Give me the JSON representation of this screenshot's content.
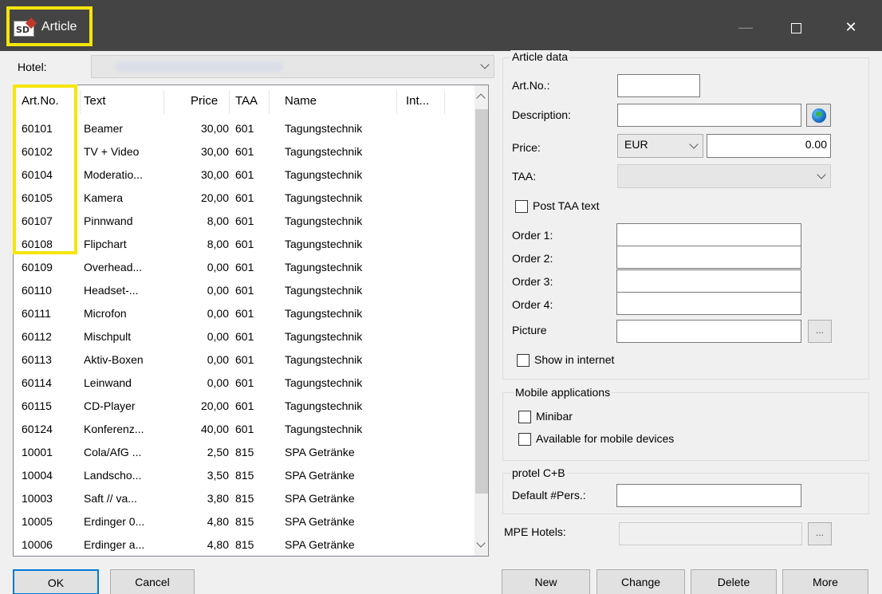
{
  "window": {
    "title": "Article",
    "icon_label": "SD",
    "controls": {
      "minimize": "—",
      "close": "✕"
    }
  },
  "hotel": {
    "label": "Hotel:",
    "value": ""
  },
  "article_list": {
    "columns": [
      "Art.No.",
      "Text",
      "Price",
      "TAA",
      "Name",
      "Int..."
    ],
    "rows": [
      {
        "art_no": "60101",
        "text": "Beamer",
        "price": "30,00",
        "taa": "601",
        "name": "Tagungstechnik"
      },
      {
        "art_no": "60102",
        "text": "TV + Video",
        "price": "30,00",
        "taa": "601",
        "name": "Tagungstechnik"
      },
      {
        "art_no": "60104",
        "text": "Moderatio...",
        "price": "30,00",
        "taa": "601",
        "name": "Tagungstechnik"
      },
      {
        "art_no": "60105",
        "text": "Kamera",
        "price": "20,00",
        "taa": "601",
        "name": "Tagungstechnik"
      },
      {
        "art_no": "60107",
        "text": "Pinnwand",
        "price": "8,00",
        "taa": "601",
        "name": "Tagungstechnik"
      },
      {
        "art_no": "60108",
        "text": "Flipchart",
        "price": "8,00",
        "taa": "601",
        "name": "Tagungstechnik"
      },
      {
        "art_no": "60109",
        "text": "Overhead...",
        "price": "0,00",
        "taa": "601",
        "name": "Tagungstechnik"
      },
      {
        "art_no": "60110",
        "text": "Headset-...",
        "price": "0,00",
        "taa": "601",
        "name": "Tagungstechnik"
      },
      {
        "art_no": "60111",
        "text": "Microfon",
        "price": "0,00",
        "taa": "601",
        "name": "Tagungstechnik"
      },
      {
        "art_no": "60112",
        "text": "Mischpult",
        "price": "0,00",
        "taa": "601",
        "name": "Tagungstechnik"
      },
      {
        "art_no": "60113",
        "text": "Aktiv-Boxen",
        "price": "0,00",
        "taa": "601",
        "name": "Tagungstechnik"
      },
      {
        "art_no": "60114",
        "text": "Leinwand",
        "price": "0,00",
        "taa": "601",
        "name": "Tagungstechnik"
      },
      {
        "art_no": "60115",
        "text": "CD-Player",
        "price": "20,00",
        "taa": "601",
        "name": "Tagungstechnik"
      },
      {
        "art_no": "60124",
        "text": "Konferenz...",
        "price": "40,00",
        "taa": "601",
        "name": "Tagungstechnik"
      },
      {
        "art_no": "10001",
        "text": "Cola/AfG ...",
        "price": "2,50",
        "taa": "815",
        "name": "SPA Getränke"
      },
      {
        "art_no": "10004",
        "text": "Landscho...",
        "price": "3,50",
        "taa": "815",
        "name": "SPA Getränke"
      },
      {
        "art_no": "10003",
        "text": "Saft // va...",
        "price": "3,80",
        "taa": "815",
        "name": "SPA Getränke"
      },
      {
        "art_no": "10005",
        "text": "Erdinger 0...",
        "price": "4,80",
        "taa": "815",
        "name": "SPA Getränke"
      },
      {
        "art_no": "10006",
        "text": "Erdinger a...",
        "price": "4,80",
        "taa": "815",
        "name": "SPA Getränke"
      }
    ]
  },
  "buttons": {
    "ok": "OK",
    "cancel": "Cancel",
    "new": "New",
    "change": "Change",
    "delete": "Delete",
    "more": "More"
  },
  "article_data": {
    "group_title": "Article data",
    "art_no_label": "Art.No.:",
    "art_no_value": "",
    "description_label": "Description:",
    "description_value": "",
    "price_label": "Price:",
    "currency": "EUR",
    "price_value": "0.00",
    "taa_label": "TAA:",
    "taa_value": "",
    "post_taa_label": "Post TAA text",
    "order_labels": [
      "Order 1:",
      "Order 2:",
      "Order 3:",
      "Order 4:"
    ],
    "picture_label": "Picture",
    "browse_label": "...",
    "show_internet_label": "Show in internet"
  },
  "mobile": {
    "group_title": "Mobile applications",
    "minibar_label": "Minibar",
    "available_label": "Available for mobile devices"
  },
  "protel": {
    "group_title": "protel C+B",
    "default_pers_label": "Default #Pers.:",
    "default_pers_value": ""
  },
  "mpe": {
    "label": "MPE Hotels:",
    "value": "",
    "browse_label": "..."
  }
}
